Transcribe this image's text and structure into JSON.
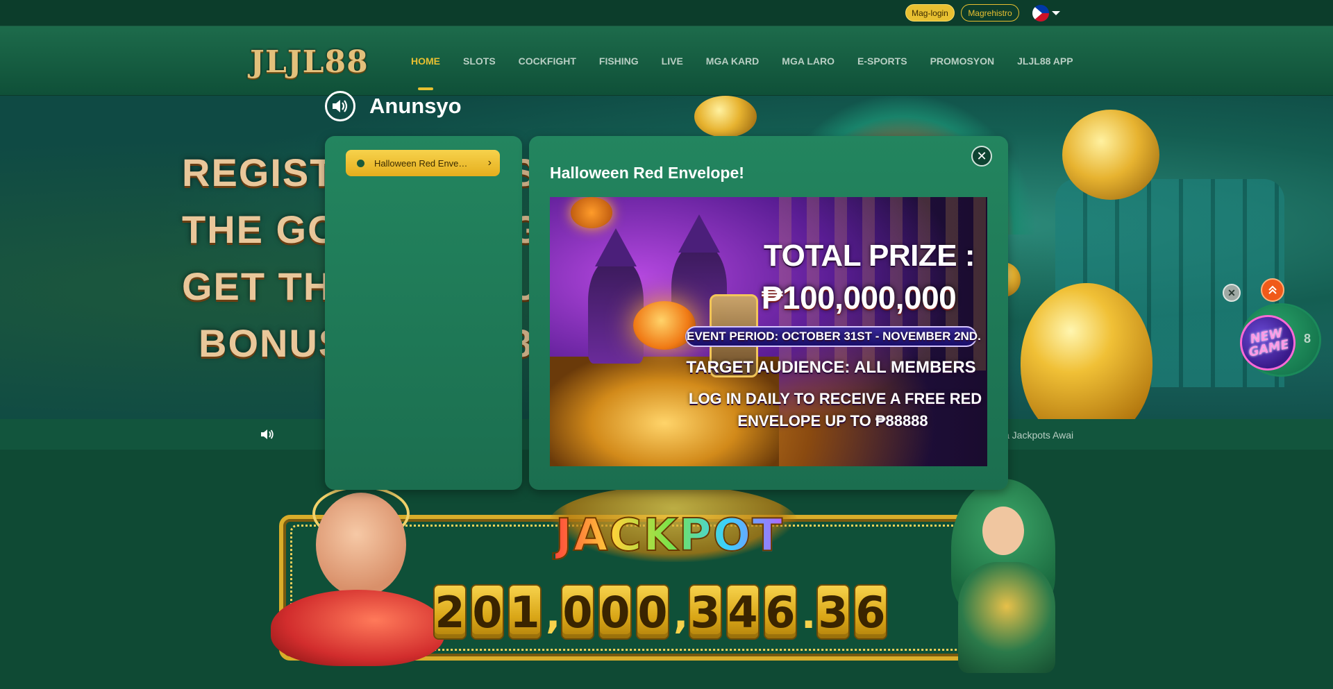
{
  "topbar": {
    "login_label": "Mag-login",
    "register_label": "Magrehistro",
    "language_icon": "philippines-flag-icon"
  },
  "header": {
    "logo_text": "JLJL88",
    "nav": [
      {
        "label": "HOME",
        "active": true
      },
      {
        "label": "SLOTS"
      },
      {
        "label": "COCKFIGHT"
      },
      {
        "label": "FISHING"
      },
      {
        "label": "LIVE"
      },
      {
        "label": "MGA KARD"
      },
      {
        "label": "MGA LARO"
      },
      {
        "label": "E-SPORTS"
      },
      {
        "label": "PROMOSYON"
      },
      {
        "label": "JLJL88 APP"
      }
    ]
  },
  "banner": {
    "lines": [
      "REGIST",
      "THE GO",
      "GET TH",
      "BONUS"
    ],
    "line_suffixes": [
      "S",
      "G",
      "U",
      "8"
    ]
  },
  "marquee": {
    "text": "a Jackpots Awai"
  },
  "jackpot": {
    "title": "JACKPOT",
    "digits": [
      "2",
      "0",
      "1",
      ",",
      "0",
      "0",
      "0",
      ",",
      "3",
      "4",
      "6",
      ".",
      "3",
      "6"
    ]
  },
  "announcement": {
    "title": "Anunsyo",
    "items": [
      {
        "label": "Halloween Red Envelope!",
        "selected": true
      }
    ],
    "detail": {
      "title": "Halloween Red Envelope!",
      "image": {
        "total_prize_label": "TOTAL PRIZE :",
        "total_prize_amount": "₱100,000,000",
        "event_period": "EVENT PERIOD: OCTOBER 31ST - NOVEMBER 2ND.",
        "target_audience": "TARGET AUDIENCE: ALL MEMBERS",
        "daily_line1": "LOG IN DAILY TO RECEIVE A FREE RED",
        "daily_line2": "ENVELOPE UP TO ₱88888"
      }
    }
  },
  "floating": {
    "new_game_line1": "NEW",
    "new_game_line2": "GAME",
    "new_game_side": "8"
  },
  "colors": {
    "accent": "#e8c031",
    "panel": "#1f7a57",
    "background": "#0f4a34"
  }
}
